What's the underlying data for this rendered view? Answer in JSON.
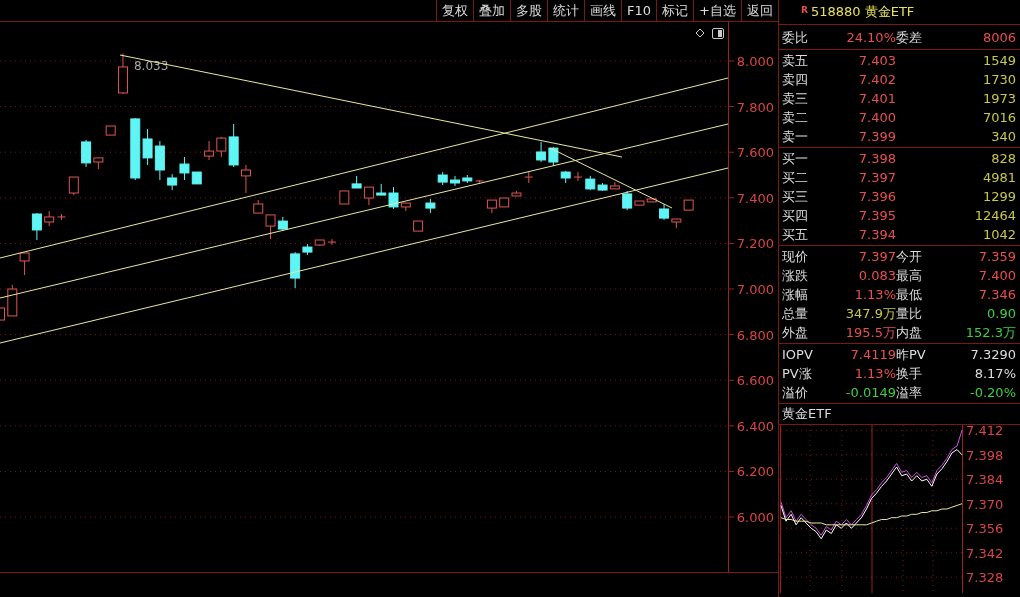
{
  "toolbar": {
    "buttons": [
      "复权",
      "叠加",
      "多股",
      "统计",
      "画线",
      "F10",
      "标记",
      "+自选",
      "返回"
    ]
  },
  "chart": {
    "chart_data": {
      "type": "candlestick",
      "grid": true,
      "ylim": [
        5.759,
        8.171
      ],
      "yticks": [
        {
          "value": 8,
          "label": "8.000"
        },
        {
          "value": 7.8,
          "label": "7.800"
        },
        {
          "value": 7.6,
          "label": "7.600"
        },
        {
          "value": 7.4,
          "label": "7.400"
        },
        {
          "value": 7.2,
          "label": "7.200"
        },
        {
          "value": 7,
          "label": "7.000"
        },
        {
          "value": 6.8,
          "label": "6.800"
        },
        {
          "value": 6.6,
          "label": "6.600"
        },
        {
          "value": 6.4,
          "label": "6.400"
        },
        {
          "value": 6.2,
          "label": "6.200"
        },
        {
          "value": 6,
          "label": "6.000"
        }
      ],
      "annotations": [
        "8.033"
      ],
      "categories": [
        null,
        null,
        null,
        null,
        null,
        null,
        null,
        null,
        null,
        null,
        null,
        null,
        null,
        null,
        null,
        null,
        null,
        null,
        null,
        null,
        null,
        null,
        null,
        null,
        null,
        null,
        null,
        null,
        null,
        null,
        null,
        null,
        null,
        null,
        null,
        null,
        null,
        null,
        null,
        null,
        null,
        null,
        null,
        null,
        null,
        null,
        null,
        null,
        null,
        null,
        null,
        null,
        null,
        null,
        null,
        null,
        null
      ],
      "ohlc": [
        [
          6.864,
          6.917,
          6.864,
          6.917
        ],
        [
          6.882,
          7.018,
          6.882,
          7.0
        ],
        [
          7.123,
          7.158,
          7.061,
          7.158
        ],
        [
          7.329,
          7.333,
          7.215,
          7.259
        ],
        [
          7.294,
          7.342,
          7.276,
          7.316
        ],
        [
          7.316,
          7.329,
          7.303,
          7.316
        ],
        [
          7.421,
          7.491,
          7.412,
          7.491
        ],
        [
          7.645,
          7.654,
          7.535,
          7.553
        ],
        [
          7.557,
          7.575,
          7.526,
          7.575
        ],
        [
          7.675,
          7.715,
          7.675,
          7.715
        ],
        [
          7.86,
          8.033,
          7.855,
          7.974
        ],
        [
          7.746,
          7.75,
          7.478,
          7.487
        ],
        [
          7.658,
          7.702,
          7.544,
          7.575
        ],
        [
          7.627,
          7.649,
          7.478,
          7.522
        ],
        [
          7.487,
          7.504,
          7.434,
          7.456
        ],
        [
          7.548,
          7.579,
          7.478,
          7.509
        ],
        [
          7.513,
          7.513,
          7.461,
          7.461
        ],
        [
          7.583,
          7.649,
          7.566,
          7.605
        ],
        [
          7.605,
          7.667,
          7.579,
          7.662
        ],
        [
          7.667,
          7.724,
          7.535,
          7.544
        ],
        [
          7.496,
          7.544,
          7.421,
          7.522
        ],
        [
          7.333,
          7.39,
          7.333,
          7.373
        ],
        [
          7.276,
          7.325,
          7.219,
          7.325
        ],
        [
          7.298,
          7.316,
          7.259,
          7.263
        ],
        [
          7.154,
          7.162,
          7.004,
          7.048
        ],
        [
          7.184,
          7.197,
          7.149,
          7.162
        ],
        [
          7.193,
          7.215,
          7.189,
          7.215
        ],
        [
          7.206,
          7.219,
          7.193,
          7.206
        ],
        [
          7.373,
          7.43,
          7.373,
          7.43
        ],
        [
          7.461,
          7.496,
          7.443,
          7.443
        ],
        [
          7.399,
          7.447,
          7.368,
          7.447
        ],
        [
          7.421,
          7.461,
          7.412,
          7.412
        ],
        [
          7.421,
          7.447,
          7.351,
          7.36
        ],
        [
          7.36,
          7.377,
          7.342,
          7.377
        ],
        [
          7.254,
          7.298,
          7.254,
          7.298
        ],
        [
          7.377,
          7.395,
          7.333,
          7.355
        ],
        [
          7.5,
          7.513,
          7.456,
          7.469
        ],
        [
          7.478,
          7.496,
          7.452,
          7.465
        ],
        [
          7.487,
          7.5,
          7.465,
          7.474
        ],
        [
          7.469,
          7.478,
          7.465,
          7.474
        ],
        [
          7.355,
          7.39,
          7.333,
          7.39
        ],
        [
          7.36,
          7.399,
          7.36,
          7.399
        ],
        [
          7.408,
          7.43,
          7.408,
          7.421
        ],
        [
          7.491,
          7.513,
          7.465,
          7.491
        ],
        [
          7.601,
          7.645,
          7.557,
          7.566
        ],
        [
          7.618,
          7.623,
          7.539,
          7.557
        ],
        [
          7.513,
          7.518,
          7.465,
          7.487
        ],
        [
          7.491,
          7.513,
          7.474,
          7.491
        ],
        [
          7.482,
          7.496,
          7.434,
          7.439
        ],
        [
          7.456,
          7.465,
          7.43,
          7.434
        ],
        [
          7.439,
          7.469,
          7.439,
          7.452
        ],
        [
          7.417,
          7.43,
          7.346,
          7.355
        ],
        [
          7.368,
          7.386,
          7.368,
          7.386
        ],
        [
          7.382,
          7.395,
          7.382,
          7.395
        ],
        [
          7.351,
          7.373,
          7.303,
          7.311
        ],
        [
          7.294,
          7.307,
          7.268,
          7.307
        ],
        [
          7.346,
          7.39,
          7.346,
          7.39
        ]
      ]
    }
  },
  "quote": {
    "badge": "R",
    "title": "518880 黄金ETF",
    "ratio": {
      "cells": [
        {
          "label": "委比",
          "value": "24.10%",
          "color": "#e85050"
        },
        {
          "label": "委差",
          "value": "8006",
          "color": "#e85050"
        }
      ]
    },
    "sell": [
      {
        "label": "卖五",
        "price": "7.403",
        "volume": "1549"
      },
      {
        "label": "卖四",
        "price": "7.402",
        "volume": "1730"
      },
      {
        "label": "卖三",
        "price": "7.401",
        "volume": "1973"
      },
      {
        "label": "卖二",
        "price": "7.400",
        "volume": "7016"
      },
      {
        "label": "卖一",
        "price": "7.399",
        "volume": "340"
      }
    ],
    "buy": [
      {
        "label": "买一",
        "price": "7.398",
        "volume": "828"
      },
      {
        "label": "买二",
        "price": "7.397",
        "volume": "4981"
      },
      {
        "label": "买三",
        "price": "7.396",
        "volume": "1299"
      },
      {
        "label": "买四",
        "price": "7.395",
        "volume": "12464"
      },
      {
        "label": "买五",
        "price": "7.394",
        "volume": "1042"
      }
    ],
    "stats": [
      {
        "cells": [
          {
            "label": "现价",
            "value": "7.397",
            "color": "#e85050"
          },
          {
            "label": "今开",
            "value": "7.359",
            "color": "#e85050"
          }
        ]
      },
      {
        "cells": [
          {
            "label": "涨跌",
            "value": "0.083",
            "color": "#e85050"
          },
          {
            "label": "最高",
            "value": "7.400",
            "color": "#e85050"
          }
        ]
      },
      {
        "cells": [
          {
            "label": "涨幅",
            "value": "1.13%",
            "color": "#e85050"
          },
          {
            "label": "最低",
            "value": "7.346",
            "color": "#e85050"
          }
        ]
      },
      {
        "cells": [
          {
            "label": "总量",
            "value": "347.9万",
            "color": "#c8c84a"
          },
          {
            "label": "量比",
            "value": "0.90",
            "color": "#3cd040"
          }
        ]
      },
      {
        "cells": [
          {
            "label": "外盘",
            "value": "195.5万",
            "color": "#e85050"
          },
          {
            "label": "内盘",
            "value": "152.3万",
            "color": "#3cd040"
          }
        ]
      }
    ],
    "nav": [
      {
        "cells": [
          {
            "label": "IOPV",
            "value": "7.4119",
            "color": "#e85050"
          },
          {
            "label": "昨PV",
            "value": "7.3290",
            "color": "#dddddd"
          }
        ]
      },
      {
        "cells": [
          {
            "label": "PV涨",
            "value": "1.13%",
            "color": "#e85050"
          },
          {
            "label": "换手",
            "value": "8.17%",
            "color": "#dddddd"
          }
        ]
      },
      {
        "cells": [
          {
            "label": "溢价",
            "value": "-0.0149",
            "color": "#3cd040"
          },
          {
            "label": "溢率",
            "value": "-0.20%",
            "color": "#3cd040"
          }
        ]
      }
    ]
  },
  "mini_chart": {
    "title": "黄金ETF",
    "chart_data": {
      "type": "line",
      "grid": true,
      "ylim": [
        7.319,
        7.415
      ],
      "yticks": [
        {
          "value": 7.412,
          "label": "7.412"
        },
        {
          "value": 7.398,
          "label": "7.398"
        },
        {
          "value": 7.384,
          "label": "7.384"
        },
        {
          "value": 7.37,
          "label": "7.370"
        },
        {
          "value": 7.356,
          "label": "7.356"
        },
        {
          "value": 7.342,
          "label": "7.342"
        },
        {
          "value": 7.328,
          "label": "7.328"
        }
      ],
      "series": [
        {
          "color": "#d050e0",
          "values": [
            7.371,
            7.362,
            7.366,
            7.36,
            7.364,
            7.361,
            7.358,
            7.356,
            7.352,
            7.357,
            7.355,
            7.36,
            7.358,
            7.361,
            7.358,
            7.361,
            7.364,
            7.369,
            7.375,
            7.378,
            7.382,
            7.385,
            7.389,
            7.393,
            7.388,
            7.389,
            7.385,
            7.388,
            7.385,
            7.386,
            7.382,
            7.389,
            7.392,
            7.396,
            7.401,
            7.403,
            7.412
          ]
        },
        {
          "color": "#ffffff",
          "values": [
            7.369,
            7.36,
            7.364,
            7.358,
            7.362,
            7.359,
            7.356,
            7.354,
            7.35,
            7.355,
            7.353,
            7.358,
            7.356,
            7.359,
            7.356,
            7.359,
            7.362,
            7.367,
            7.373,
            7.376,
            7.38,
            7.383,
            7.387,
            7.391,
            7.386,
            7.387,
            7.383,
            7.386,
            7.383,
            7.384,
            7.38,
            7.387,
            7.39,
            7.394,
            7.399,
            7.401,
            7.398
          ]
        },
        {
          "color": "#e8e8a0",
          "values": [
            7.362,
            7.361,
            7.361,
            7.36,
            7.36,
            7.36,
            7.359,
            7.359,
            7.359,
            7.358,
            7.358,
            7.358,
            7.358,
            7.358,
            7.358,
            7.358,
            7.358,
            7.358,
            7.359,
            7.36,
            7.361,
            7.361,
            7.362,
            7.362,
            7.363,
            7.363,
            7.364,
            7.364,
            7.365,
            7.365,
            7.366,
            7.366,
            7.367,
            7.367,
            7.368,
            7.369,
            7.37
          ]
        }
      ]
    }
  }
}
